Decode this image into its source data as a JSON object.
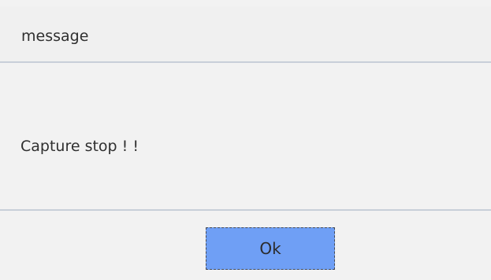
{
  "dialog": {
    "title": "message",
    "message": "Capture stop ! !",
    "ok_label": "Ok"
  },
  "colors": {
    "background": "#f2f2f2",
    "divider": "#c8cfd9",
    "button": "#6f9ff5",
    "text": "#2f2f2f"
  }
}
